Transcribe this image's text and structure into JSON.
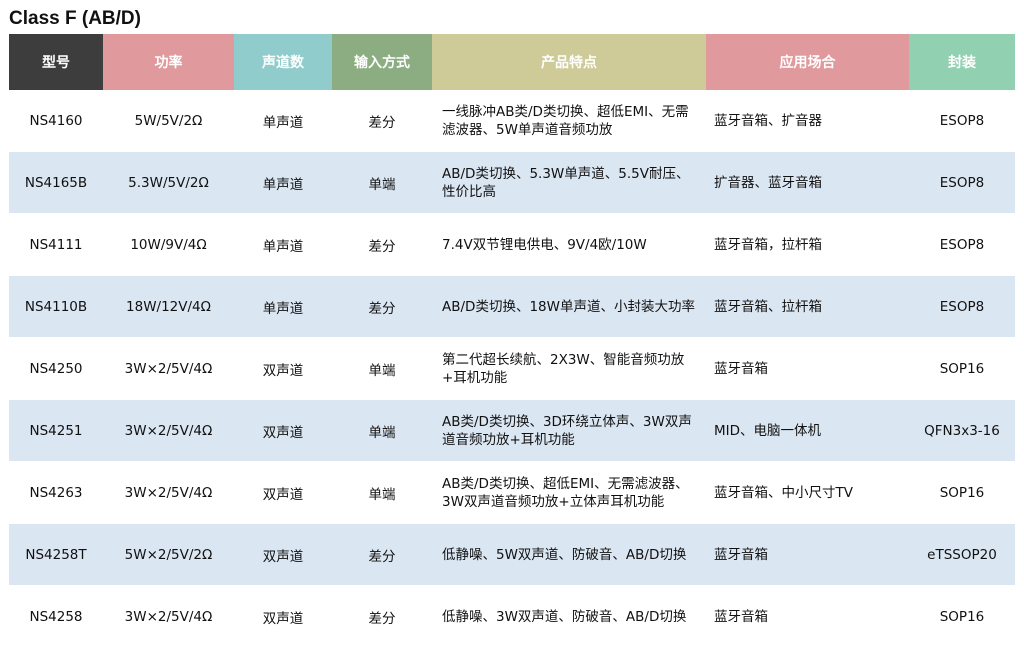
{
  "title": "Class F (AB/D)",
  "colors": {
    "header": [
      "#3d3d3d",
      "#e0999c",
      "#91cccc",
      "#8cad82",
      "#cfcb99",
      "#e0999c",
      "#91d1b1"
    ],
    "row_alt": "#dbe6f3"
  },
  "headers": [
    "型号",
    "功率",
    "声道数",
    "输入方式",
    "产品特点",
    "应用场合",
    "封装"
  ],
  "rows": [
    {
      "model": "NS4160",
      "power": "5W/5V/2Ω",
      "channels": "单声道",
      "input": "差分",
      "features": "一线脉冲AB类/D类切换、超低EMI、无需滤波器、5W单声道音频功放",
      "application": "蓝牙音箱、扩音器",
      "package": "ESOP8"
    },
    {
      "model": "NS4165B",
      "power": "5.3W/5V/2Ω",
      "channels": "单声道",
      "input": "单端",
      "features": "AB/D类切换、5.3W单声道、5.5V耐压、性价比高",
      "application": "扩音器、蓝牙音箱",
      "package": "ESOP8"
    },
    {
      "model": "NS4111",
      "power": "10W/9V/4Ω",
      "channels": "单声道",
      "input": "差分",
      "features": "7.4V双节锂电供电、9V/4欧/10W",
      "application": "蓝牙音箱，拉杆箱",
      "package": "ESOP8"
    },
    {
      "model": "NS4110B",
      "power": "18W/12V/4Ω",
      "channels": "单声道",
      "input": "差分",
      "features": "AB/D类切换、18W单声道、小封装大功率",
      "application": "蓝牙音箱、拉杆箱",
      "package": "ESOP8"
    },
    {
      "model": "NS4250",
      "power": "3W×2/5V/4Ω",
      "channels": "双声道",
      "input": "单端",
      "features": "第二代超长续航、2X3W、智能音频功放+耳机功能",
      "application": "蓝牙音箱",
      "package": "SOP16"
    },
    {
      "model": "NS4251",
      "power": "3W×2/5V/4Ω",
      "channels": "双声道",
      "input": "单端",
      "features": "AB类/D类切换、3D环绕立体声、3W双声道音频功放+耳机功能",
      "application": "MID、电脑一体机",
      "package": "QFN3x3-16"
    },
    {
      "model": "NS4263",
      "power": "3W×2/5V/4Ω",
      "channels": "双声道",
      "input": "单端",
      "features": "AB类/D类切换、超低EMI、无需滤波器、3W双声道音频功放+立体声耳机功能",
      "application": "蓝牙音箱、中小尺寸TV",
      "package": "SOP16"
    },
    {
      "model": "NS4258T",
      "power": "5W×2/5V/2Ω",
      "channels": "双声道",
      "input": "差分",
      "features": "低静噪、5W双声道、防破音、AB/D切换",
      "application": "蓝牙音箱",
      "package": "eTSSOP20"
    },
    {
      "model": "NS4258",
      "power": "3W×2/5V/4Ω",
      "channels": "双声道",
      "input": "差分",
      "features": "低静噪、3W双声道、防破音、AB/D切换",
      "application": "蓝牙音箱",
      "package": "SOP16"
    }
  ]
}
